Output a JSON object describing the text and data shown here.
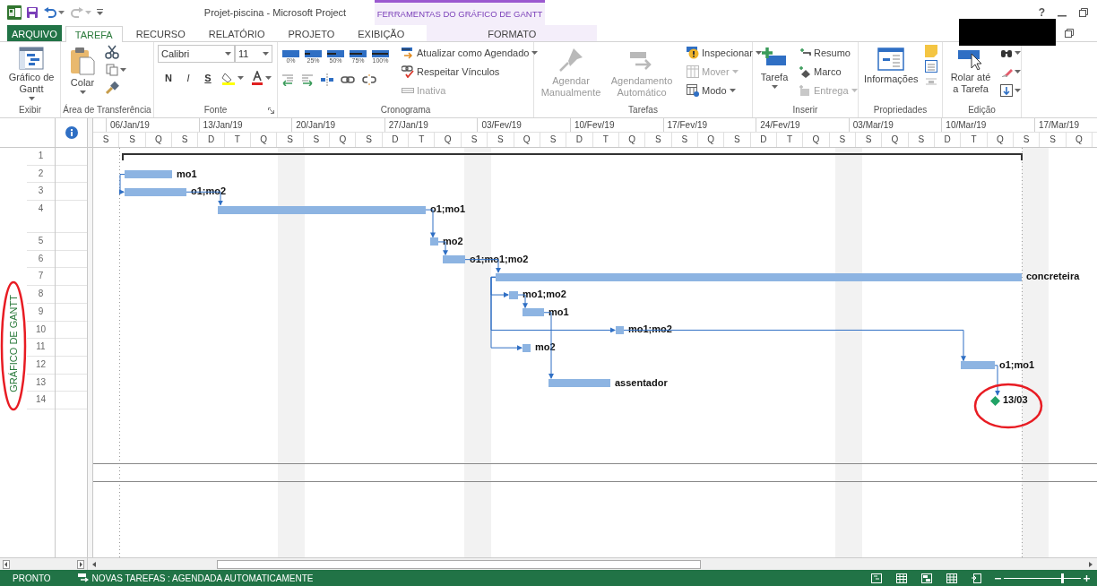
{
  "title_bar": {
    "title": "Projet-piscina - Microsoft Project",
    "context_group": "FERRAMENTAS DO GRÁFICO DE GANTT",
    "help": "?"
  },
  "tabs": [
    {
      "label": "ARQUIVO",
      "kind": "file",
      "selected": false
    },
    {
      "label": "TAREFA",
      "kind": "tab",
      "selected": true
    },
    {
      "label": "RECURSO",
      "kind": "tab",
      "selected": false
    },
    {
      "label": "RELATÓRIO",
      "kind": "tab",
      "selected": false
    },
    {
      "label": "PROJETO",
      "kind": "tab",
      "selected": false
    },
    {
      "label": "EXIBIÇÃO",
      "kind": "tab",
      "selected": false
    },
    {
      "label": "FORMATO",
      "kind": "context",
      "selected": false
    }
  ],
  "ribbon": {
    "view_group": {
      "title": "Exibir",
      "gantt_button": "Gráfico de Gantt"
    },
    "clipboard_group": {
      "title": "Área de Transferência",
      "paste_button": "Colar"
    },
    "font_group": {
      "title": "Fonte",
      "font_name": "Calibri",
      "font_size": "11",
      "bold": "N",
      "italic": "I",
      "underline": "S"
    },
    "schedule_group": {
      "title": "Cronograma",
      "percent_buttons": [
        "0%",
        "25%",
        "50%",
        "75%",
        "100%"
      ],
      "commands": [
        {
          "label": "Atualizar como Agendado",
          "dropdown": true,
          "disabled": false
        },
        {
          "label": "Respeitar Vínculos",
          "dropdown": false,
          "disabled": false
        },
        {
          "label": "Inativa",
          "dropdown": false,
          "disabled": true
        }
      ]
    },
    "tasks_group": {
      "title": "Tarefas",
      "large_buttons": [
        {
          "label": "Agendar Manualmente",
          "disabled": true
        },
        {
          "label": "Agendamento Automático",
          "disabled": true
        }
      ],
      "commands": [
        {
          "label": "Inspecionar",
          "dropdown": true,
          "disabled": false
        },
        {
          "label": "Mover",
          "dropdown": true,
          "disabled": true
        },
        {
          "label": "Modo",
          "dropdown": true,
          "disabled": false
        }
      ]
    },
    "insert_group": {
      "title": "Inserir",
      "task_button": "Tarefa",
      "commands": [
        {
          "label": "Resumo",
          "dropdown": false,
          "disabled": false
        },
        {
          "label": "Marco",
          "dropdown": false,
          "disabled": false
        },
        {
          "label": "Entrega",
          "dropdown": true,
          "disabled": true
        }
      ]
    },
    "properties_group": {
      "title": "Propriedades",
      "info_button": "Informações"
    },
    "editing_group": {
      "title": "Edição",
      "scroll_button": "Rolar até a Tarefa"
    }
  },
  "timescale": {
    "weeks": [
      "06/Jan/19",
      "13/Jan/19",
      "20/Jan/19",
      "27/Jan/19",
      "03/Fev/19",
      "10/Fev/19",
      "17/Fev/19",
      "24/Fev/19",
      "03/Mar/19",
      "10/Mar/19",
      "17/Mar/19"
    ],
    "days": [
      "S",
      "S",
      "Q",
      "S",
      "D",
      "T",
      "Q",
      "S",
      "S",
      "Q",
      "S",
      "D",
      "T",
      "Q",
      "S",
      "S",
      "Q",
      "S",
      "D",
      "T",
      "Q",
      "S",
      "S",
      "Q",
      "S",
      "D",
      "T",
      "Q",
      "S",
      "S",
      "Q",
      "S",
      "D",
      "T",
      "Q",
      "S",
      "S",
      "Q"
    ]
  },
  "gantt": {
    "side_label": "GRÁFICO DE GANTT",
    "rows": [
      {
        "number": "1",
        "wrapped": false,
        "bar": {
          "kind": "summary"
        }
      },
      {
        "number": "2",
        "wrapped": false,
        "bar": {
          "kind": "task",
          "label": "mo1"
        }
      },
      {
        "number": "3",
        "wrapped": false,
        "bar": {
          "kind": "task",
          "label": "o1;mo2"
        }
      },
      {
        "number": "4",
        "wrapped": true,
        "bar": {
          "kind": "task",
          "label": "o1;mo1"
        }
      },
      {
        "number": "5",
        "wrapped": false,
        "bar": {
          "kind": "task",
          "label": "mo2"
        }
      },
      {
        "number": "6",
        "wrapped": false,
        "bar": {
          "kind": "task",
          "label": "o1;mo1;mo2"
        }
      },
      {
        "number": "7",
        "wrapped": false,
        "bar": {
          "kind": "task",
          "label": "concreteira"
        }
      },
      {
        "number": "8",
        "wrapped": false,
        "bar": {
          "kind": "task",
          "label": "mo1;mo2"
        }
      },
      {
        "number": "9",
        "wrapped": false,
        "bar": {
          "kind": "task",
          "label": "mo1"
        }
      },
      {
        "number": "10",
        "wrapped": false,
        "bar": {
          "kind": "task",
          "label": "mo1;mo2"
        }
      },
      {
        "number": "11",
        "wrapped": false,
        "bar": {
          "kind": "task",
          "label": "mo2"
        }
      },
      {
        "number": "12",
        "wrapped": false,
        "bar": {
          "kind": "task",
          "label": "o1;mo1"
        }
      },
      {
        "number": "13",
        "wrapped": false,
        "bar": {
          "kind": "task",
          "label": "assentador"
        }
      },
      {
        "number": "14",
        "wrapped": false,
        "bar": {
          "kind": "milestone",
          "label": "13/03"
        }
      }
    ]
  },
  "status_bar": {
    "mode": "PRONTO",
    "new_tasks": "NOVAS TAREFAS : AGENDADA AUTOMATICAMENTE",
    "zoom": {
      "level": 0.75
    }
  }
}
